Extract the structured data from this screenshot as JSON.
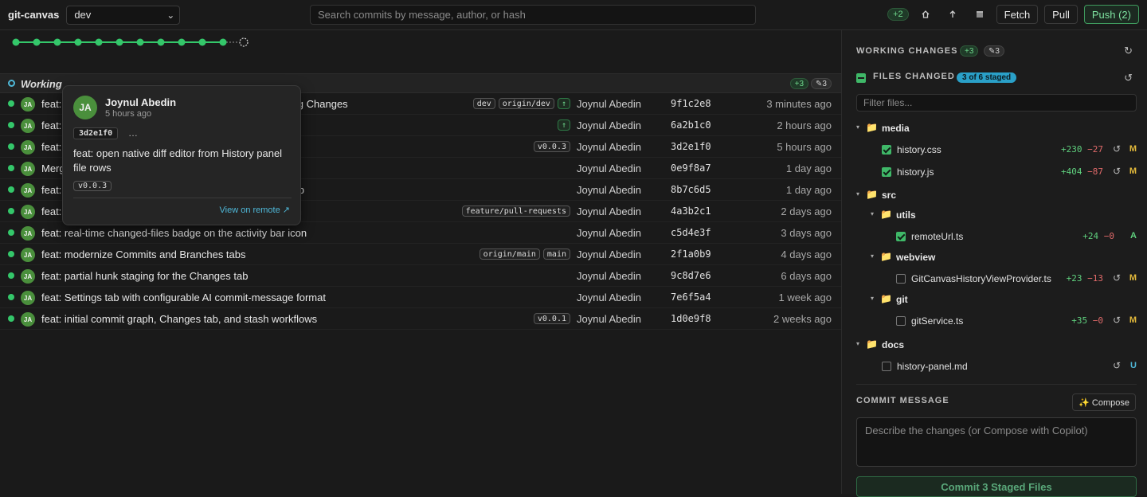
{
  "app": {
    "title": "git-canvas"
  },
  "branch": {
    "selected": "dev"
  },
  "search": {
    "placeholder": "Search commits by message, author, or hash"
  },
  "toolbar": {
    "ahead_badge": "+2",
    "fetch_label": "Fetch",
    "pull_label": "Pull",
    "push_label": "Push (2)",
    "icons": [
      "home-icon",
      "arrow-up-icon",
      "archive-icon"
    ]
  },
  "working_row": {
    "label": "Working",
    "added_badge": "+3",
    "modified_badge": "✎3"
  },
  "commits": [
    {
      "avatar": "JA",
      "message": "feat: History panel: inline diff preview, tooltip and Working Changes",
      "refs": [
        {
          "label": "dev",
          "kind": "branch"
        },
        {
          "label": "origin/dev",
          "kind": "branch"
        },
        {
          "label": "↑",
          "kind": "up"
        }
      ],
      "author": "Joynul Abedin",
      "hash": "9f1c2e8",
      "time": "3 minutes ago"
    },
    {
      "avatar": "JA",
      "message": "feat: open native diff editor from History panel file rows",
      "refs": [
        {
          "label": "↑",
          "kind": "up"
        }
      ],
      "author": "Joynul Abedin",
      "hash": "6a2b1c0",
      "time": "2 hours ago"
    },
    {
      "avatar": "JA",
      "message": "feat: open native diff editor from History panel file rows",
      "refs": [
        {
          "label": "v0.0.3",
          "kind": "tag"
        }
      ],
      "author": "Joynul Abedin",
      "hash": "3d2e1f0",
      "time": "5 hours ago"
    },
    {
      "avatar": "JA",
      "message": "Merge branch 'feature/settings' into dev",
      "refs": [],
      "author": "Joynul Abedin",
      "hash": "0e9f8a7",
      "time": "1 day ago"
    },
    {
      "avatar": "JA",
      "message": "feat: stash apply, pop and drop actions in the Stashes tab",
      "refs": [],
      "author": "Joynul Abedin",
      "hash": "8b7c6d5",
      "time": "1 day ago"
    },
    {
      "avatar": "JA",
      "message": "feat: scaffold PR compare diff and description generation",
      "refs": [
        {
          "label": "feature/pull-requests",
          "kind": "branch"
        }
      ],
      "author": "Joynul Abedin",
      "hash": "4a3b2c1",
      "time": "2 days ago"
    },
    {
      "avatar": "JA",
      "message": "feat: real-time changed-files badge on the activity bar icon",
      "refs": [],
      "author": "Joynul Abedin",
      "hash": "c5d4e3f",
      "time": "3 days ago"
    },
    {
      "avatar": "JA",
      "message": "feat: modernize Commits and Branches tabs",
      "refs": [
        {
          "label": "origin/main",
          "kind": "branch"
        },
        {
          "label": "main",
          "kind": "branch"
        }
      ],
      "author": "Joynul Abedin",
      "hash": "2f1a0b9",
      "time": "4 days ago"
    },
    {
      "avatar": "JA",
      "message": "feat: partial hunk staging for the Changes tab",
      "refs": [],
      "author": "Joynul Abedin",
      "hash": "9c8d7e6",
      "time": "6 days ago"
    },
    {
      "avatar": "JA",
      "message": "feat: Settings tab with configurable AI commit-message format",
      "refs": [],
      "author": "Joynul Abedin",
      "hash": "7e6f5a4",
      "time": "1 week ago"
    },
    {
      "avatar": "JA",
      "message": "feat: initial commit graph, Changes tab, and stash workflows",
      "refs": [
        {
          "label": "v0.0.1",
          "kind": "tag"
        }
      ],
      "author": "Joynul Abedin",
      "hash": "1d0e9f8",
      "time": "2 weeks ago"
    }
  ],
  "tooltip": {
    "avatar": "JA",
    "author": "Joynul Abedin",
    "time": "5 hours ago",
    "hash": "3d2e1f0",
    "ellipsis": "…",
    "message": "feat: open native diff editor from History panel file rows",
    "tag": "v0.0.3",
    "remote_link": "View on remote ↗"
  },
  "changes": {
    "title": "WORKING CHANGES",
    "added_badge": "+3",
    "modified_badge": "✎3",
    "files_changed_title": "FILES CHANGED",
    "staged_pill": "3 of 6 staged",
    "filter_placeholder": "Filter files...",
    "tree": [
      {
        "type": "folder",
        "name": "media",
        "depth": 0
      },
      {
        "type": "file",
        "name": "history.css",
        "depth": 1,
        "checked": true,
        "add": "+230",
        "del": "−27",
        "status": "M"
      },
      {
        "type": "file",
        "name": "history.js",
        "depth": 1,
        "checked": true,
        "add": "+404",
        "del": "−87",
        "status": "M"
      },
      {
        "type": "folder",
        "name": "src",
        "depth": 0
      },
      {
        "type": "folder",
        "name": "utils",
        "depth": 1
      },
      {
        "type": "file",
        "name": "remoteUrl.ts",
        "depth": 2,
        "checked": true,
        "add": "+24",
        "del": "−0",
        "status": "A"
      },
      {
        "type": "folder",
        "name": "webview",
        "depth": 1
      },
      {
        "type": "file",
        "name": "GitCanvasHistoryViewProvider.ts",
        "depth": 2,
        "checked": false,
        "add": "+23",
        "del": "−13",
        "status": "M"
      },
      {
        "type": "folder",
        "name": "git",
        "depth": 1
      },
      {
        "type": "file",
        "name": "gitService.ts",
        "depth": 2,
        "checked": false,
        "add": "+35",
        "del": "−0",
        "status": "M"
      },
      {
        "type": "folder",
        "name": "docs",
        "depth": 0
      },
      {
        "type": "file",
        "name": "history-panel.md",
        "depth": 1,
        "checked": false,
        "add": "",
        "del": "",
        "status": "U"
      }
    ]
  },
  "commit_message": {
    "title": "COMMIT MESSAGE",
    "compose_label": "✨ Compose",
    "placeholder": "Describe the changes (or Compose with Copilot)",
    "commit_button": "Commit 3 Staged Files"
  },
  "colors": {
    "accent_green": "#34c76a",
    "accent_blue": "#4fb8d8",
    "modified": "#e2b93b"
  }
}
